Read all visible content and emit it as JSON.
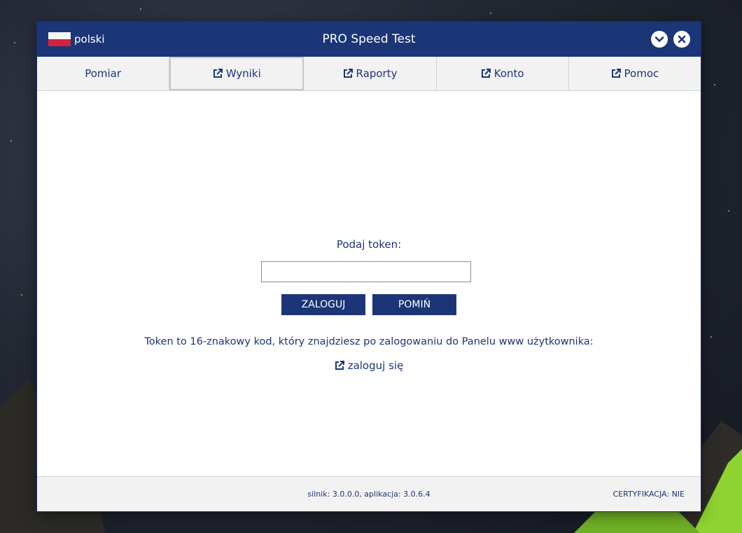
{
  "window": {
    "title": "PRO Speed Test",
    "language": "polski"
  },
  "tabs": [
    {
      "label": "Pomiar",
      "external": false
    },
    {
      "label": "Wyniki",
      "external": true,
      "active": true
    },
    {
      "label": "Raporty",
      "external": true
    },
    {
      "label": "Konto",
      "external": true
    },
    {
      "label": "Pomoc",
      "external": true
    }
  ],
  "login": {
    "prompt": "Podaj token:",
    "token_value": "",
    "login_button": "ZALOGUJ",
    "skip_button": "POMIŃ",
    "info": "Token to 16-znakowy kod, który znajdziesz po zalogowaniu do Panelu www użytkownika:",
    "link_label": "zaloguj się"
  },
  "footer": {
    "version": "silnik: 3.0.0.0, aplikacja: 3.0.6.4",
    "certification": "CERTYFIKACJA: NIE"
  },
  "colors": {
    "primary": "#1b3577",
    "tab_bg": "#f2f2f2",
    "flag_white": "#f4f4f4",
    "flag_red": "#d4213d"
  },
  "icons": {
    "minimize": "chevron-down-icon",
    "close": "close-icon",
    "external": "external-link-icon",
    "flag": "poland-flag-icon"
  }
}
